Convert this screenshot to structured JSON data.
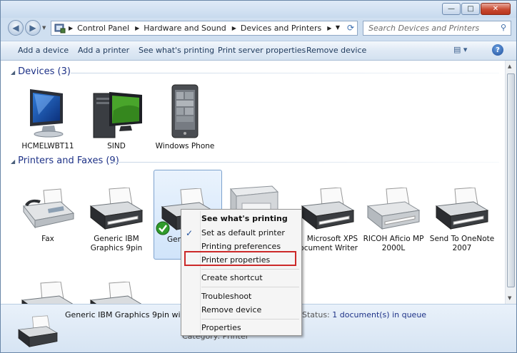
{
  "window": {
    "buttons": {
      "minimize": "—",
      "maximize": "□",
      "close": "✕"
    }
  },
  "address": {
    "crumbs": [
      "Control Panel",
      "Hardware and Sound",
      "Devices and Printers"
    ],
    "separator": "▶"
  },
  "search": {
    "placeholder": "Search Devices and Printers"
  },
  "toolbar": {
    "add_device": "Add a device",
    "add_printer": "Add a printer",
    "see_printing": "See what's printing",
    "print_server": "Print server properties",
    "remove_device": "Remove device",
    "views_icon": "▤ ▾",
    "help_icon": "?"
  },
  "devices": {
    "header": "Devices (3)",
    "items": [
      {
        "label": "HCMELWBT11",
        "icon": "monitor-icon"
      },
      {
        "label": "SIND",
        "icon": "computer-icon"
      },
      {
        "label": "Windows Phone",
        "icon": "phone-icon"
      }
    ]
  },
  "printers": {
    "header": "Printers and Faxes (9)",
    "items": [
      {
        "label": "Fax",
        "icon": "fax-icon"
      },
      {
        "label": "Generic IBM Graphics 9pin",
        "icon": "printer-icon"
      },
      {
        "label": "Gene Graph w",
        "icon": "printer-icon",
        "selected": true
      },
      {
        "label": "",
        "icon": "laser-printer-icon"
      },
      {
        "label": "Microsoft XPS ocument Writer",
        "icon": "printer-icon"
      },
      {
        "label": "RICOH Aficio MP 2000L",
        "icon": "printer-icon"
      },
      {
        "label": "Send To OneNote 2007",
        "icon": "printer-icon"
      }
    ]
  },
  "details": {
    "name": "Generic IBM Graphics 9pin wide",
    "status_label": "Status:",
    "status_value": "1 document(s) in queue",
    "category_label": "Category:",
    "category_value": "Printer"
  },
  "context_menu": {
    "items": [
      "See what's printing",
      "Set as default printer",
      "Printing preferences",
      "Printer properties",
      "Create shortcut",
      "Troubleshoot",
      "Remove device",
      "Properties"
    ],
    "check": "✓"
  },
  "colors": {
    "highlight_box": "#cc2929",
    "group_header": "#1e3287",
    "selection": "#d0e4fa"
  }
}
